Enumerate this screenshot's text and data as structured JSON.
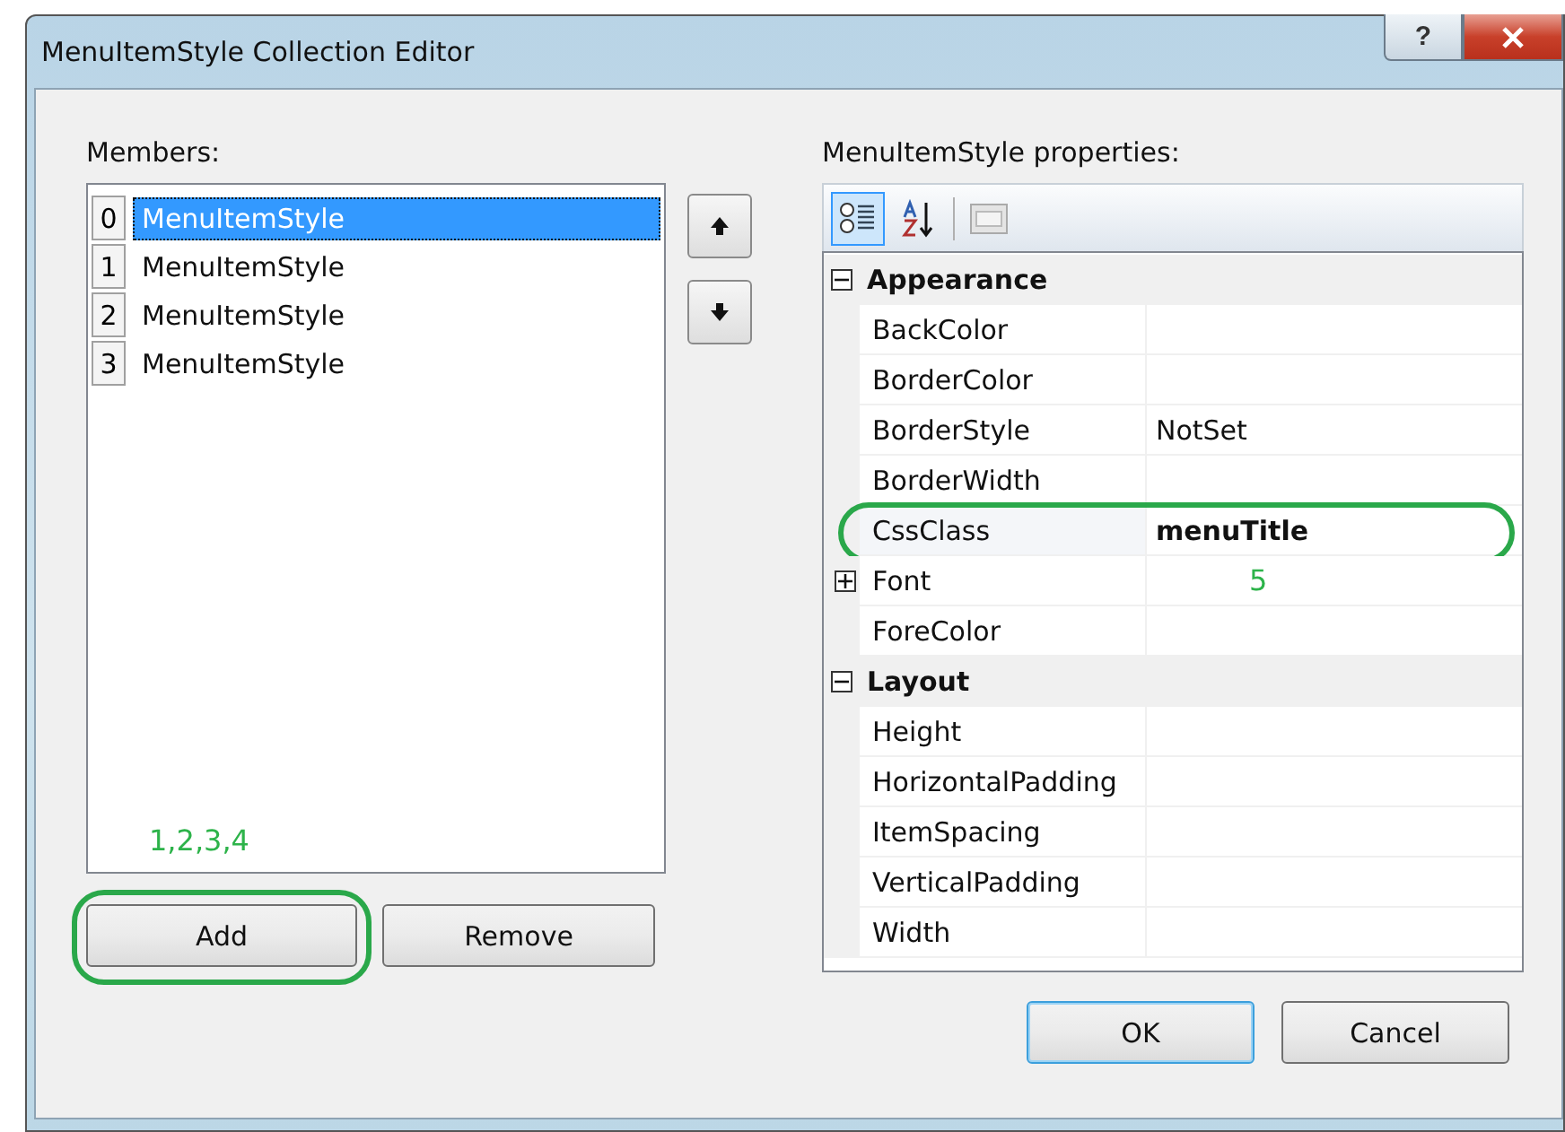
{
  "window": {
    "title": "MenuItemStyle Collection Editor",
    "help_button": "?"
  },
  "members": {
    "label": "Members:",
    "items": [
      {
        "index": "0",
        "name": "MenuItemStyle",
        "selected": true
      },
      {
        "index": "1",
        "name": "MenuItemStyle",
        "selected": false
      },
      {
        "index": "2",
        "name": "MenuItemStyle",
        "selected": false
      },
      {
        "index": "3",
        "name": "MenuItemStyle",
        "selected": false
      }
    ],
    "annotation": "1,2,3,4",
    "buttons": [
      {
        "label": "Add",
        "circled": true
      },
      {
        "label": "Remove",
        "circled": false
      }
    ]
  },
  "properties": {
    "label": "MenuItemStyle properties:",
    "toolbar": [
      {
        "kind": "categorized",
        "selected": true
      },
      {
        "kind": "alphabetical",
        "selected": false
      },
      {
        "kind": "pages",
        "selected": false
      }
    ],
    "categories": [
      {
        "name": "Appearance",
        "expanded": true,
        "rows": [
          {
            "name": "BackColor",
            "value": ""
          },
          {
            "name": "BorderColor",
            "value": ""
          },
          {
            "name": "BorderStyle",
            "value": "NotSet"
          },
          {
            "name": "BorderWidth",
            "value": ""
          },
          {
            "name": "CssClass",
            "value": "menuTitle",
            "modified": true,
            "circled": true
          },
          {
            "name": "Font",
            "value": "",
            "expanded": false,
            "annotation": "5"
          },
          {
            "name": "ForeColor",
            "value": ""
          }
        ]
      },
      {
        "name": "Layout",
        "expanded": true,
        "rows": [
          {
            "name": "Height",
            "value": ""
          },
          {
            "name": "HorizontalPadding",
            "value": ""
          },
          {
            "name": "ItemSpacing",
            "value": ""
          },
          {
            "name": "VerticalPadding",
            "value": ""
          },
          {
            "name": "Width",
            "value": ""
          }
        ]
      }
    ]
  },
  "dialog_buttons": [
    {
      "label": "OK",
      "default": true
    },
    {
      "label": "Cancel",
      "default": false
    }
  ]
}
